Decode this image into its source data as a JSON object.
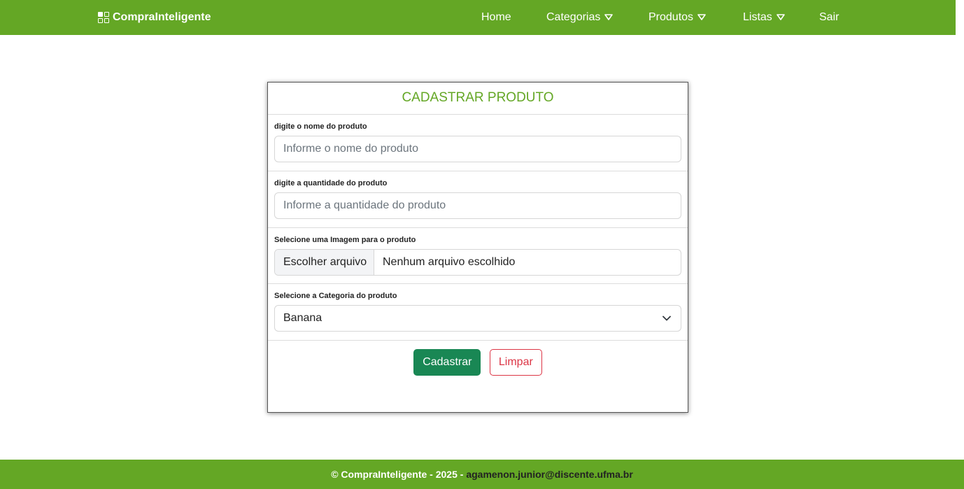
{
  "header": {
    "brand": "CompraInteligente",
    "nav": [
      {
        "label": "Home",
        "dropdown": false
      },
      {
        "label": "Categorias",
        "dropdown": true
      },
      {
        "label": "Produtos",
        "dropdown": true
      },
      {
        "label": "Listas",
        "dropdown": true
      },
      {
        "label": "Sair",
        "dropdown": false
      }
    ]
  },
  "form": {
    "title": "CADASTRAR PRODUTO",
    "name_label": "digite o nome do produto",
    "name_placeholder": "Informe o nome do produto",
    "qty_label": "digite a quantidade do produto",
    "qty_placeholder": "Informe a quantidade do produto",
    "image_label": "Selecione uma Imagem para o produto",
    "file_button": "Escolher arquivo",
    "file_status": "Nenhum arquivo escolhido",
    "category_label": "Selecione a Categoria do produto",
    "category_selected": "Banana",
    "submit_label": "Cadastrar",
    "clear_label": "Limpar"
  },
  "footer": {
    "text": "© CompraInteligente - 2025 -",
    "email": "agamenon.junior@discente.ufma.br"
  },
  "colors": {
    "brand_green": "#64a725",
    "primary_button": "#198754",
    "danger": "#dc3545"
  }
}
